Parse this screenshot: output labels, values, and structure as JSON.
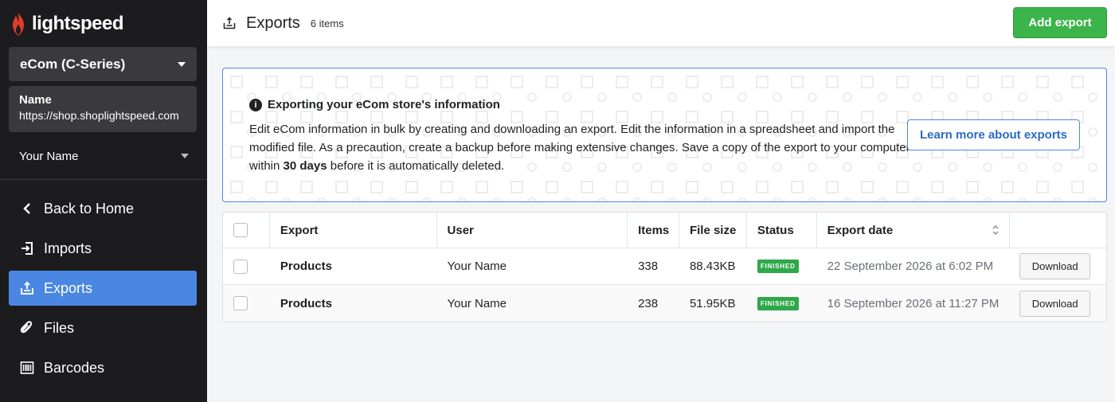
{
  "brand": {
    "name": "lightspeed"
  },
  "sidebar": {
    "store_select": {
      "label": "eCom (C-Series)"
    },
    "store_info": {
      "name_label": "Name",
      "url": "https://shop.shoplightspeed.com"
    },
    "user": {
      "name": "Your Name"
    },
    "nav": [
      {
        "label": "Back to Home",
        "icon": "chevron-left-icon"
      },
      {
        "label": "Imports",
        "icon": "import-icon"
      },
      {
        "label": "Exports",
        "icon": "export-icon",
        "active": true
      },
      {
        "label": "Files",
        "icon": "paperclip-icon"
      },
      {
        "label": "Barcodes",
        "icon": "barcode-icon"
      }
    ]
  },
  "header": {
    "title": "Exports",
    "count": "6 items",
    "add_label": "Add export"
  },
  "info": {
    "title": "Exporting your eCom store's information",
    "text_pre": "Edit eCom information in bulk by creating and downloading an export. Edit the information in a spreadsheet and import the modified file. As a precaution, create a backup before making extensive changes. Save a copy of the export to your computer within ",
    "text_bold": "30 days",
    "text_post": " before it is automatically deleted.",
    "button_label": "Learn more about exports"
  },
  "table": {
    "columns": {
      "export": "Export",
      "user": "User",
      "items": "Items",
      "size": "File size",
      "status": "Status",
      "date": "Export date"
    },
    "rows": [
      {
        "export": "Products",
        "user": "Your Name",
        "items": "338",
        "size": "88.43KB",
        "status": "FINISHED",
        "date": "22 September 2026 at 6:02 PM",
        "action": "Download"
      },
      {
        "export": "Products",
        "user": "Your Name",
        "items": "238",
        "size": "51.95KB",
        "status": "FINISHED",
        "date": "16 September 2026 at 11:27 PM",
        "action": "Download"
      }
    ]
  },
  "colors": {
    "sidebar_bg": "#1c1c1e",
    "accent": "#4a87e2",
    "success": "#3bb44a"
  }
}
